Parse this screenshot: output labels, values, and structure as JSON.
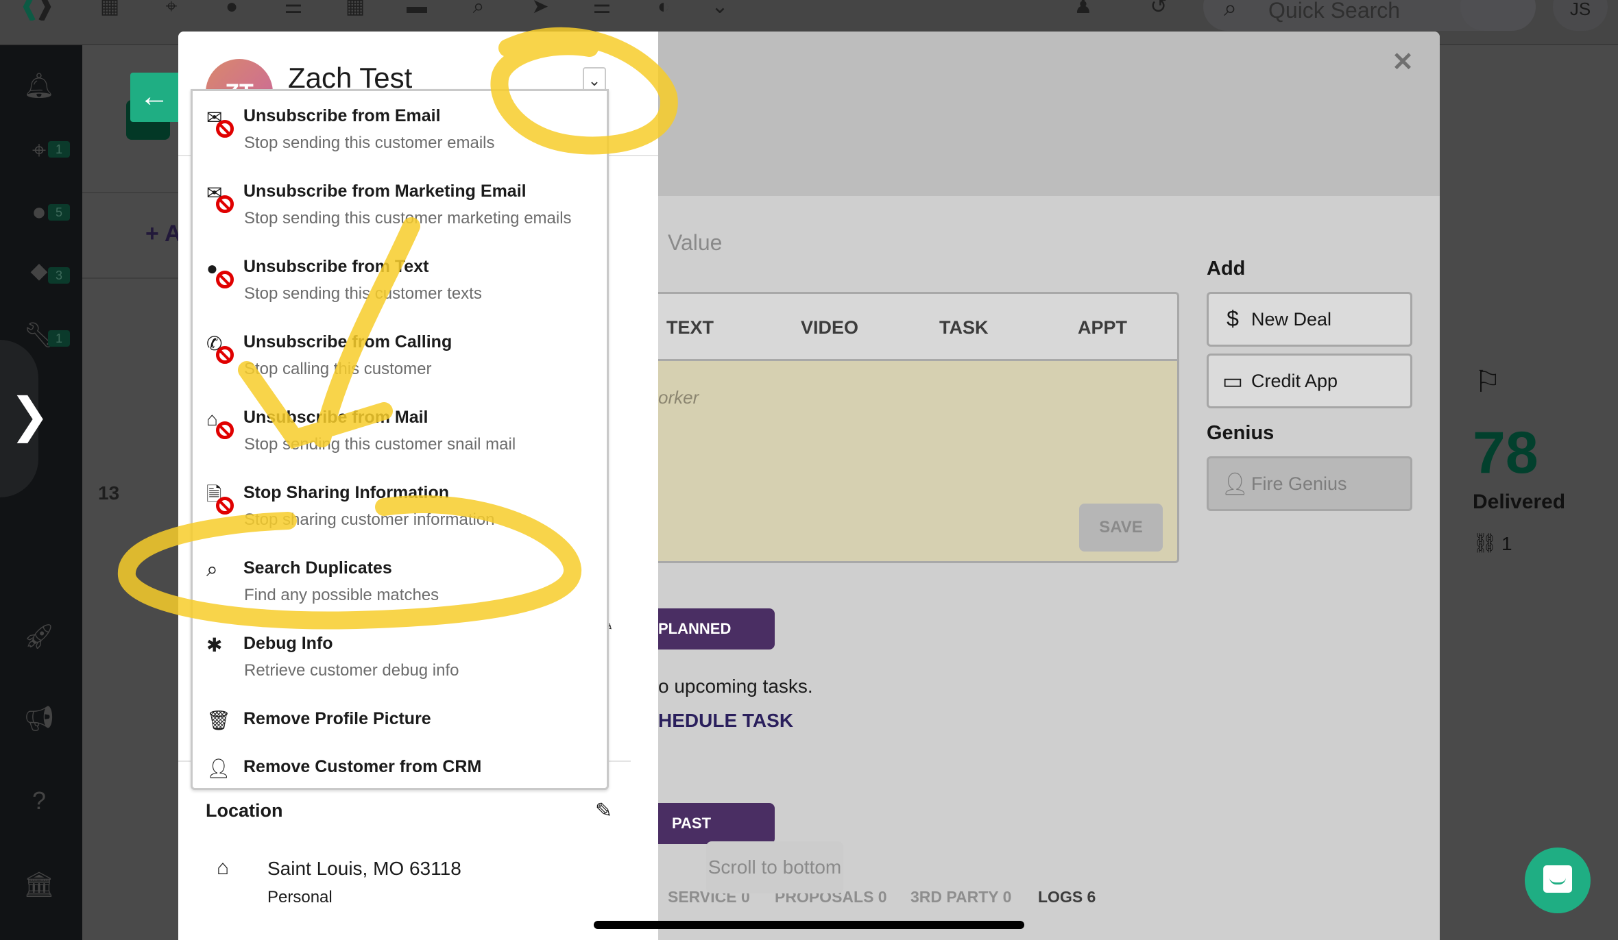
{
  "topnav": {
    "icons": [
      "app-logo",
      "calculator-icon",
      "crosshairs-icon",
      "comments-icon",
      "list-icon",
      "grid-icon",
      "car-icon",
      "search-plus-icon",
      "paper-plane-icon",
      "ordered-list-icon",
      "gauge-icon",
      "chevron-down-icon",
      "user-plus-icon",
      "history-icon"
    ],
    "search_placeholder": "Quick Search",
    "user_initials": "JS"
  },
  "sidebar": {
    "items": [
      {
        "icon": "bell-icon",
        "badge": null
      },
      {
        "icon": "crosshairs-icon",
        "badge": "1"
      },
      {
        "icon": "comments-icon",
        "badge": "5"
      },
      {
        "icon": "map-marker-icon",
        "badge": "3"
      },
      {
        "icon": "wrench-icon",
        "badge": "1"
      },
      {
        "icon": "rocket-icon",
        "badge": null
      },
      {
        "icon": "megaphone-icon",
        "badge": null
      },
      {
        "icon": "help-icon",
        "badge": null
      },
      {
        "icon": "bank-icon",
        "badge": null
      }
    ],
    "expand_glyph": "❯"
  },
  "background": {
    "add_label": "+ A",
    "count_13": "13",
    "stat_value": "78",
    "stat_label": "Delivered",
    "unlinked_count": "1"
  },
  "customer": {
    "initials": "ZT",
    "name": "Zach Test"
  },
  "menu": {
    "items": [
      {
        "title": "Unsubscribe from Email",
        "subtitle": "Stop sending this customer emails",
        "icon": "envelope-icon",
        "blocked": true
      },
      {
        "title": "Unsubscribe from Marketing Email",
        "subtitle": "Stop sending this customer marketing emails",
        "icon": "envelope-icon",
        "blocked": true
      },
      {
        "title": "Unsubscribe from Text",
        "subtitle": "Stop sending this customer texts",
        "icon": "comments-icon",
        "blocked": true
      },
      {
        "title": "Unsubscribe from Calling",
        "subtitle": "Stop calling this customer",
        "icon": "phone-icon",
        "blocked": true
      },
      {
        "title": "Unsubscribe from Mail",
        "subtitle": "Stop sending this customer snail mail",
        "icon": "home-icon",
        "blocked": true
      },
      {
        "title": "Stop Sharing Information",
        "subtitle": "Stop sharing customer information",
        "icon": "document-icon",
        "blocked": true
      },
      {
        "title": "Search Duplicates",
        "subtitle": "Find any possible matches",
        "icon": "search-icon",
        "blocked": false
      },
      {
        "title": "Debug Info",
        "subtitle": "Retrieve customer debug info",
        "icon": "bug-icon",
        "blocked": false
      },
      {
        "title": "Remove Profile Picture",
        "subtitle": "",
        "icon": "trash-icon",
        "blocked": false
      },
      {
        "title": "Remove Customer from CRM",
        "subtitle": "",
        "icon": "user-times-icon",
        "blocked": false
      }
    ]
  },
  "location": {
    "title": "Location",
    "address": "Saint Louis, MO 63118",
    "type": "Personal"
  },
  "composer": {
    "value_label": "Value",
    "tabs": [
      "TEXT",
      "VIDEO",
      "TASK",
      "APPT"
    ],
    "placeholder_fragment": "orker",
    "save_label": "SAVE"
  },
  "add_panel": {
    "add_title": "Add",
    "new_deal": "New Deal",
    "credit_app": "Credit App",
    "genius_title": "Genius",
    "fire_genius": "Fire Genius"
  },
  "tasks": {
    "planned_label": "PLANNED",
    "no_tasks": "o upcoming tasks.",
    "schedule_task": "HEDULE TASK",
    "past_label": "PAST"
  },
  "scroll_to_bottom": "Scroll to bottom",
  "bottom_tabs": [
    {
      "label": "SERVICE 0",
      "active": false
    },
    {
      "label": "PROPOSALS 0",
      "active": false
    },
    {
      "label": "3RD PARTY 0",
      "active": false
    },
    {
      "label": "LOGS 6",
      "active": true
    }
  ],
  "colors": {
    "brand_green": "#1fae83",
    "purple": "#4a2e63",
    "annotation_yellow": "#f7cd2a",
    "block_red": "#e00000"
  }
}
